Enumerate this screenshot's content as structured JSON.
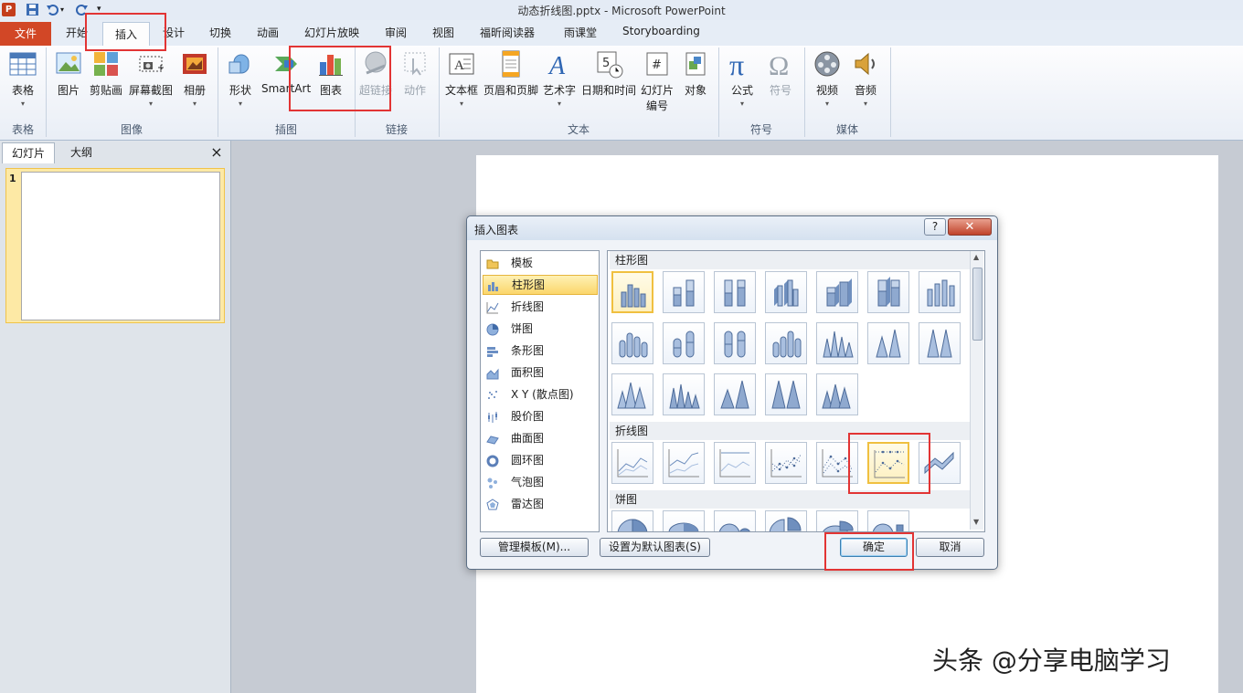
{
  "window": {
    "title": "动态折线图.pptx - Microsoft PowerPoint"
  },
  "tabs": {
    "file": "文件",
    "items": [
      "开始",
      "插入",
      "设计",
      "切换",
      "动画",
      "幻灯片放映",
      "审阅",
      "视图",
      "福昕阅读器",
      "雨课堂",
      "Storyboarding"
    ],
    "active": "插入"
  },
  "ribbon": {
    "groups": [
      {
        "label": "表格",
        "buttons": [
          "表格"
        ]
      },
      {
        "label": "图像",
        "buttons": [
          "图片",
          "剪贴画",
          "屏幕截图",
          "相册"
        ]
      },
      {
        "label": "插图",
        "buttons": [
          "形状",
          "SmartArt",
          "图表"
        ]
      },
      {
        "label": "链接",
        "buttons": [
          "超链接",
          "动作"
        ]
      },
      {
        "label": "文本",
        "buttons": [
          "文本框",
          "页眉和页脚",
          "艺术字",
          "日期和时间",
          "幻灯片",
          "对象"
        ],
        "extra": "编号"
      },
      {
        "label": "符号",
        "buttons": [
          "公式",
          "符号"
        ]
      },
      {
        "label": "媒体",
        "buttons": [
          "视频",
          "音频"
        ]
      }
    ]
  },
  "left_panel": {
    "tabs": [
      "幻灯片",
      "大纲"
    ],
    "close": "×",
    "slide_number": "1"
  },
  "dialog": {
    "title": "插入图表",
    "help": "?",
    "close": "✕",
    "categories": [
      "模板",
      "柱形图",
      "折线图",
      "饼图",
      "条形图",
      "面积图",
      "X Y (散点图)",
      "股价图",
      "曲面图",
      "圆环图",
      "气泡图",
      "雷达图"
    ],
    "selected_category": "柱形图",
    "sections": [
      "柱形图",
      "折线图",
      "饼图"
    ],
    "buttons": {
      "manage": "管理模板(M)...",
      "set_default": "设置为默认图表(S)",
      "ok": "确定",
      "cancel": "取消"
    }
  },
  "watermark": "头条 @分享电脑学习",
  "colors": {
    "file_tab": "#d24726",
    "highlight": "#e23434",
    "selection": "#fbd66b"
  }
}
